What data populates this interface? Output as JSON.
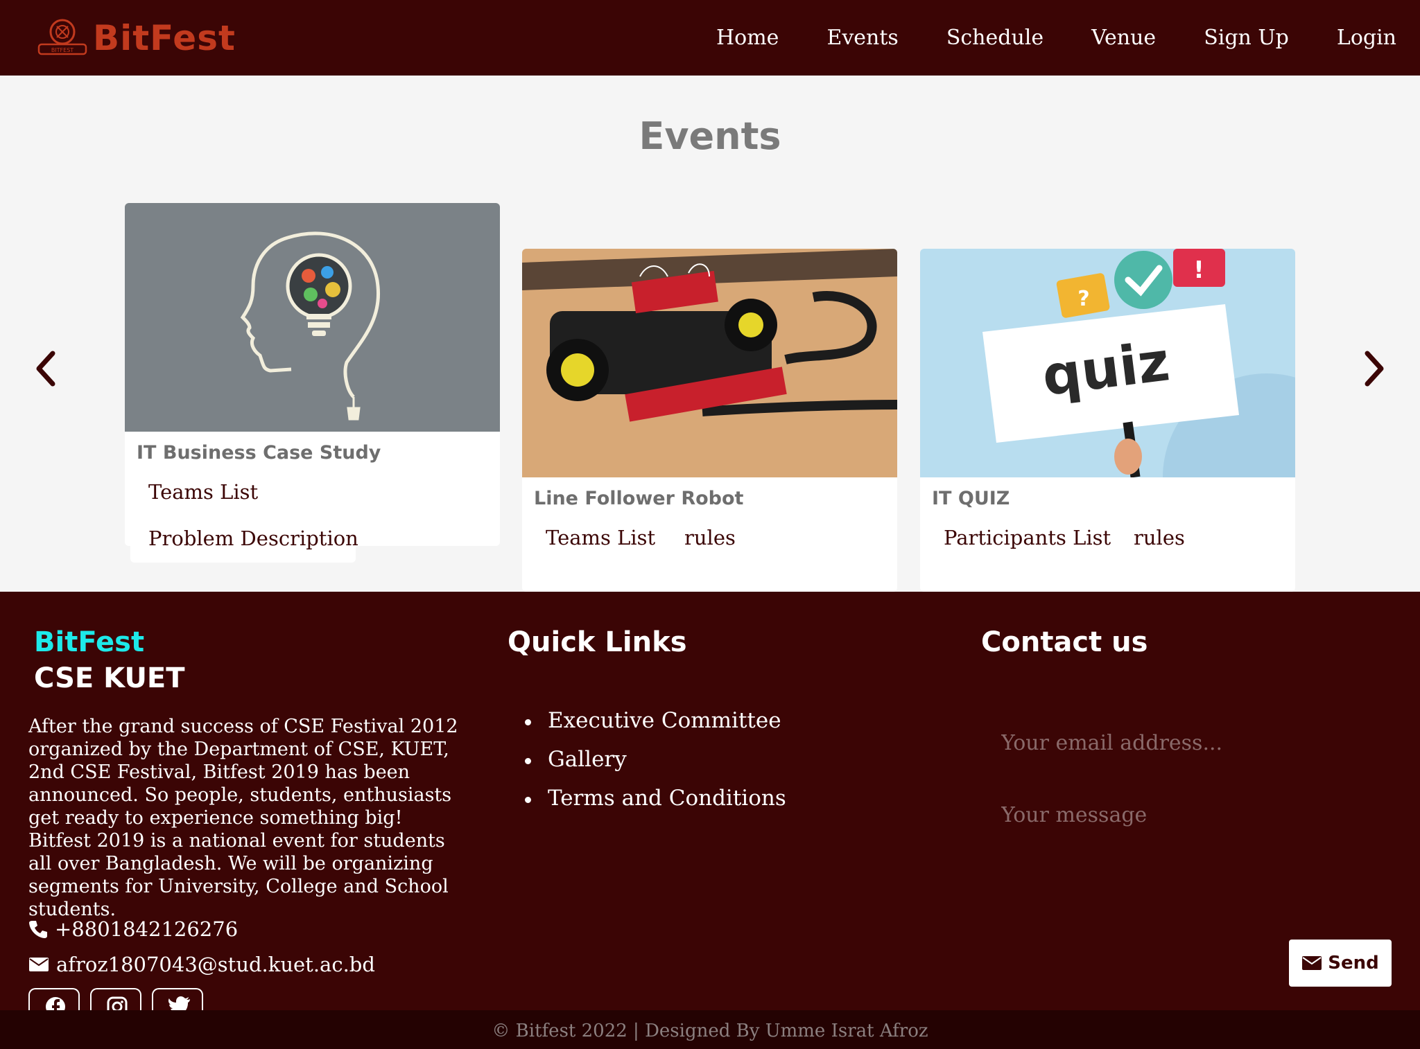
{
  "brand": {
    "name": "BitFest",
    "badge_text": "BITFEST"
  },
  "nav": {
    "items": [
      {
        "label": "Home"
      },
      {
        "label": "Events"
      },
      {
        "label": "Schedule"
      },
      {
        "label": "Venue"
      },
      {
        "label": "Sign Up"
      },
      {
        "label": "Login"
      }
    ]
  },
  "events": {
    "title": "Events",
    "cards": [
      {
        "title": "IT Business Case Study",
        "links": [
          "Teams List",
          "Problem Description"
        ]
      },
      {
        "title": "Line Follower Robot",
        "links": [
          "Teams List",
          "rules"
        ]
      },
      {
        "title": "IT QUIZ",
        "links": [
          "Participants List",
          "rules"
        ],
        "sign_text": "quiz"
      }
    ]
  },
  "footer": {
    "brand_line1": "BitFest",
    "brand_line2": "CSE KUET",
    "about": "After the grand success of CSE Festival 2012 organized by the Department of CSE, KUET, 2nd CSE Festival, Bitfest 2019 has been announced. So people, students, enthusiasts get ready to experience something big! Bitfest 2019 is a national event for students all over Bangladesh. We will be organizing segments for University, College and School students.",
    "phone": "+8801842126276",
    "email": "afroz1807043@stud.kuet.ac.bd",
    "quick_links_title": "Quick Links",
    "quick_links": [
      "Executive Committee",
      "Gallery",
      "Terms and Conditions"
    ],
    "contact_title": "Contact us",
    "email_placeholder": "Your email address...",
    "message_placeholder": "Your message",
    "send_label": "Send",
    "copyright": "© Bitfest 2022 | Designed By Umme Israt Afroz"
  },
  "colors": {
    "maroon": "#3b0505",
    "cyan": "#1de9e9",
    "brand_red": "#c23a1e"
  }
}
